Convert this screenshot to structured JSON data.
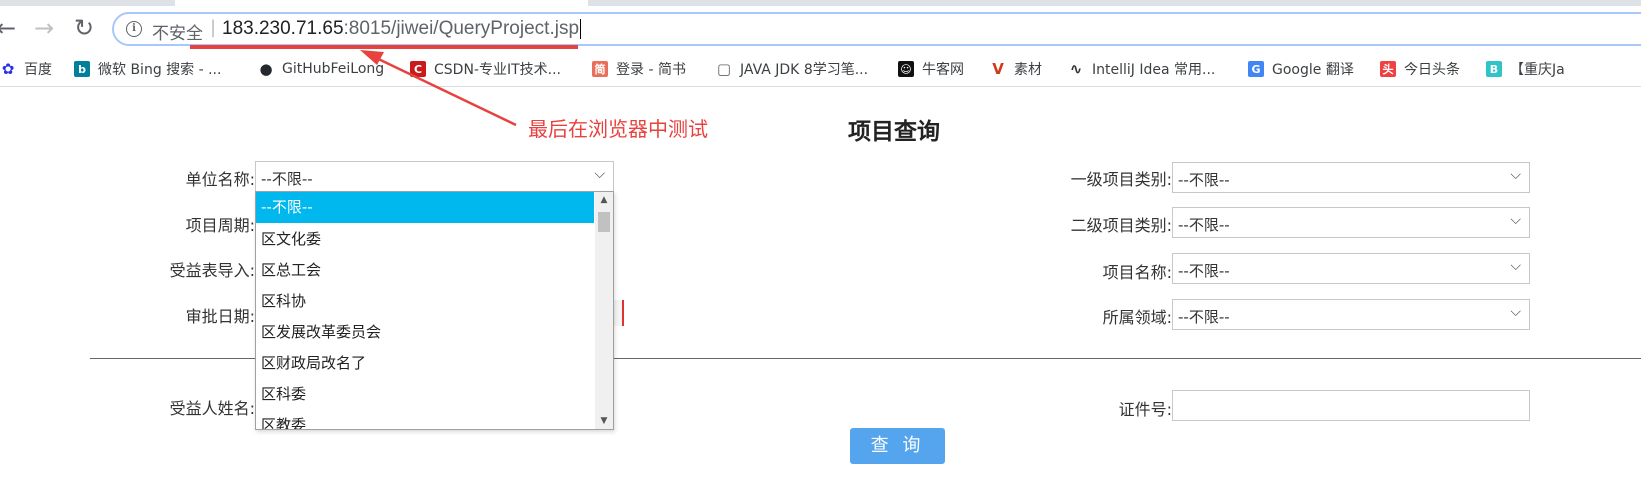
{
  "browser": {
    "security_label": "不安全",
    "separator": "|",
    "url_host": "183.230.71.65",
    "url_path": ":8015/jiwei/QueryProject.jsp",
    "back_glyph": "←",
    "forward_glyph": "→",
    "reload_glyph": "↻"
  },
  "bookmarks": [
    {
      "label": "百度",
      "icon": "baidu-paw-icon",
      "color": "#2932e1"
    },
    {
      "label": "微软 Bing 搜索 - ...",
      "icon": "bing-icon",
      "color": "#00809d"
    },
    {
      "label": "GitHubFeiLong",
      "icon": "github-icon",
      "color": "#24292e"
    },
    {
      "label": "CSDN-专业IT技术...",
      "icon": "csdn-icon",
      "color": "#c91b1b"
    },
    {
      "label": "登录 - 简书",
      "icon": "jianshu-icon",
      "color": "#ea6f5a"
    },
    {
      "label": "JAVA JDK 8学习笔...",
      "icon": "page-icon",
      "color": "#5f6368"
    },
    {
      "label": "牛客网",
      "icon": "nowcoder-icon",
      "color": "#111111"
    },
    {
      "label": "素材",
      "icon": "v-icon",
      "color": "#d03a1a"
    },
    {
      "label": "IntelliJ Idea 常用...",
      "icon": "intellij-icon",
      "color": "#333333"
    },
    {
      "label": "Google 翻译",
      "icon": "google-translate-icon",
      "color": "#4285f4"
    },
    {
      "label": "今日头条",
      "icon": "toutiao-icon",
      "color": "#f04142"
    },
    {
      "label": "【重庆Ja",
      "icon": "b-icon",
      "color": "#2fc4c8"
    }
  ],
  "annotation": "最后在浏览器中测试",
  "page": {
    "title": "项目查询",
    "labels": {
      "unit_name": "单位名称:",
      "project_period": "项目周期:",
      "beneficiary_import": "受益表导入:",
      "approval_date": "审批日期:",
      "level1_category": "一级项目类别:",
      "level2_category": "二级项目类别:",
      "project_name": "项目名称:",
      "field": "所属领域:",
      "beneficiary_name": "受益人姓名:",
      "id_number": "证件号:"
    },
    "selects": {
      "unit_name": "--不限--",
      "level1_category": "--不限--",
      "level2_category": "--不限--",
      "project_name": "--不限--",
      "field": "--不限--"
    },
    "query_button": "查 询"
  },
  "dropdown": {
    "selected_index": 0,
    "options": [
      "--不限--",
      "区文化委",
      "区总工会",
      "区科协",
      "区发展改革委员会",
      "区财政局改名了",
      "区科委",
      "区教委"
    ]
  }
}
